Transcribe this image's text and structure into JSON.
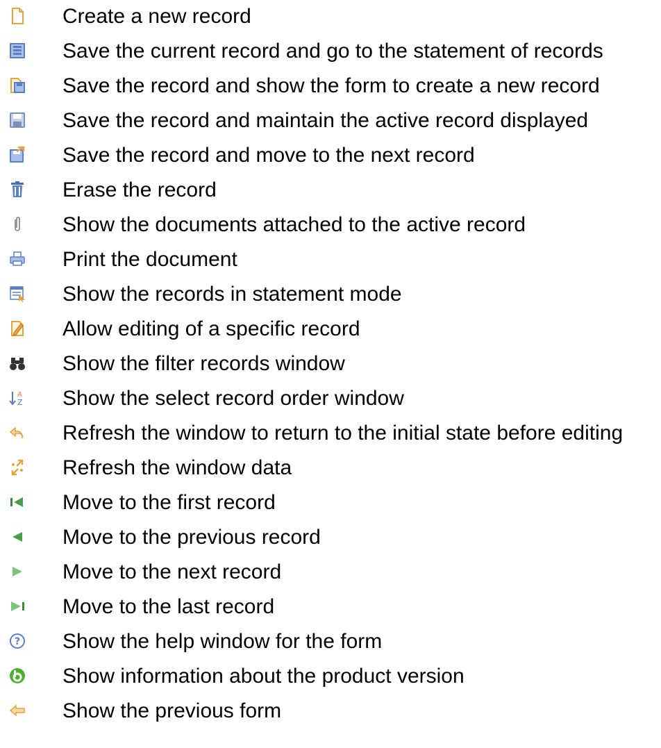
{
  "colors": {
    "text": "#000000",
    "icon_blue": "#5b7fc6",
    "icon_light_blue": "#a8c0e8",
    "icon_green": "#3a8a3a",
    "icon_orange": "#e8a33c",
    "icon_gray": "#8a8a8a"
  },
  "legend": {
    "items": [
      {
        "icon": "new-record-icon",
        "label": "Create a new record"
      },
      {
        "icon": "save-and-list-icon",
        "label": "Save the current record and go to the statement of records"
      },
      {
        "icon": "save-and-new-icon",
        "label": "Save the record and show the form to create a new record"
      },
      {
        "icon": "save-icon",
        "label": "Save the record and maintain the active record displayed"
      },
      {
        "icon": "save-and-next-icon",
        "label": "Save the record and move to the next record"
      },
      {
        "icon": "trash-icon",
        "label": "Erase the record"
      },
      {
        "icon": "paperclip-icon",
        "label": "Show the documents attached to the active record"
      },
      {
        "icon": "printer-icon",
        "label": "Print the document"
      },
      {
        "icon": "statement-mode-icon",
        "label": "Show the records in statement mode"
      },
      {
        "icon": "edit-record-icon",
        "label": "Allow editing of a specific record"
      },
      {
        "icon": "binoculars-icon",
        "label": "Show the filter records window"
      },
      {
        "icon": "sort-order-icon",
        "label": "Show the select record order window"
      },
      {
        "icon": "undo-icon",
        "label": "Refresh the window to return to the initial state before editing"
      },
      {
        "icon": "refresh-icon",
        "label": "Refresh the window data"
      },
      {
        "icon": "first-record-icon",
        "label": "Move to the first record"
      },
      {
        "icon": "previous-record-icon",
        "label": "Move to the previous record"
      },
      {
        "icon": "next-record-icon",
        "label": "Move to the next record"
      },
      {
        "icon": "last-record-icon",
        "label": "Move to the last record"
      },
      {
        "icon": "help-icon",
        "label": "Show the help window for the form"
      },
      {
        "icon": "product-info-icon",
        "label": "Show information about the product version"
      },
      {
        "icon": "back-arrow-icon",
        "label": "Show the previous form"
      }
    ]
  }
}
